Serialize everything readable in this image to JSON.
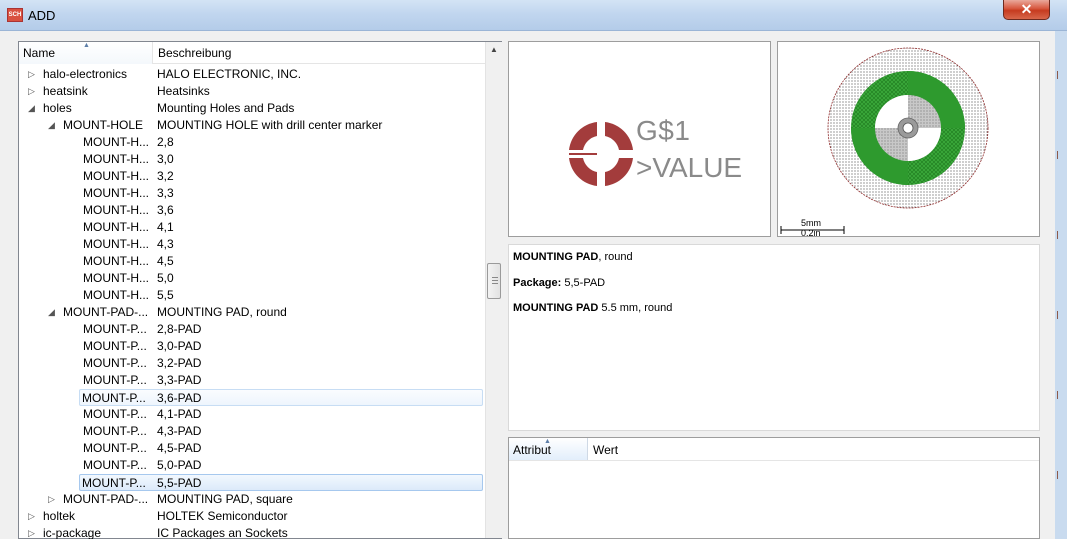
{
  "window": {
    "title": "ADD",
    "app_icon": "SCH",
    "close_label": "✕"
  },
  "tree": {
    "columns": {
      "name": "Name",
      "description": "Beschreibung"
    },
    "rows": [
      {
        "level": 0,
        "expander": "collapsed",
        "name": "halo-electronics",
        "desc": "HALO ELECTRONIC, INC."
      },
      {
        "level": 0,
        "expander": "collapsed",
        "name": "heatsink",
        "desc": "Heatsinks"
      },
      {
        "level": 0,
        "expander": "expanded",
        "name": "holes",
        "desc": "Mounting Holes and Pads"
      },
      {
        "level": 1,
        "expander": "expanded",
        "name": "MOUNT-HOLE",
        "desc": "MOUNTING HOLE with drill center marker"
      },
      {
        "level": 2,
        "expander": "none",
        "name": "MOUNT-H...",
        "desc": "2,8"
      },
      {
        "level": 2,
        "expander": "none",
        "name": "MOUNT-H...",
        "desc": "3,0"
      },
      {
        "level": 2,
        "expander": "none",
        "name": "MOUNT-H...",
        "desc": "3,2"
      },
      {
        "level": 2,
        "expander": "none",
        "name": "MOUNT-H...",
        "desc": "3,3"
      },
      {
        "level": 2,
        "expander": "none",
        "name": "MOUNT-H...",
        "desc": "3,6"
      },
      {
        "level": 2,
        "expander": "none",
        "name": "MOUNT-H...",
        "desc": "4,1"
      },
      {
        "level": 2,
        "expander": "none",
        "name": "MOUNT-H...",
        "desc": "4,3"
      },
      {
        "level": 2,
        "expander": "none",
        "name": "MOUNT-H...",
        "desc": "4,5"
      },
      {
        "level": 2,
        "expander": "none",
        "name": "MOUNT-H...",
        "desc": "5,0"
      },
      {
        "level": 2,
        "expander": "none",
        "name": "MOUNT-H...",
        "desc": "5,5"
      },
      {
        "level": 1,
        "expander": "expanded",
        "name": "MOUNT-PAD-...",
        "desc": "MOUNTING PAD, round"
      },
      {
        "level": 2,
        "expander": "none",
        "name": "MOUNT-P...",
        "desc": "2,8-PAD"
      },
      {
        "level": 2,
        "expander": "none",
        "name": "MOUNT-P...",
        "desc": "3,0-PAD"
      },
      {
        "level": 2,
        "expander": "none",
        "name": "MOUNT-P...",
        "desc": "3,2-PAD"
      },
      {
        "level": 2,
        "expander": "none",
        "name": "MOUNT-P...",
        "desc": "3,3-PAD"
      },
      {
        "level": 2,
        "expander": "none",
        "name": "MOUNT-P...",
        "desc": "3,6-PAD",
        "state": "hover"
      },
      {
        "level": 2,
        "expander": "none",
        "name": "MOUNT-P...",
        "desc": "4,1-PAD"
      },
      {
        "level": 2,
        "expander": "none",
        "name": "MOUNT-P...",
        "desc": "4,3-PAD"
      },
      {
        "level": 2,
        "expander": "none",
        "name": "MOUNT-P...",
        "desc": "4,5-PAD"
      },
      {
        "level": 2,
        "expander": "none",
        "name": "MOUNT-P...",
        "desc": "5,0-PAD"
      },
      {
        "level": 2,
        "expander": "none",
        "name": "MOUNT-P...",
        "desc": "5,5-PAD",
        "state": "selected"
      },
      {
        "level": 1,
        "expander": "collapsed",
        "name": "MOUNT-PAD-...",
        "desc": "MOUNTING PAD, square"
      },
      {
        "level": 0,
        "expander": "collapsed",
        "name": "holtek",
        "desc": "HOLTEK Semiconductor"
      },
      {
        "level": 0,
        "expander": "collapsed",
        "name": "ic-package",
        "desc": "IC Packages an Sockets"
      }
    ]
  },
  "symbol_preview": {
    "name": "G$1",
    "value": ">VALUE"
  },
  "package_preview": {
    "scale_metric": "5mm",
    "scale_imperial": "0.2in"
  },
  "description": {
    "line1_bold": "MOUNTING PAD",
    "line1_rest": ", round",
    "line2_bold": "Package:",
    "line2_rest": " 5,5-PAD",
    "line3_bold": "MOUNTING PAD",
    "line3_rest": " 5.5 mm, round"
  },
  "attributes": {
    "columns": {
      "attribute": "Attribut",
      "value": "Wert"
    }
  },
  "colors": {
    "symbol_red": "#a33c3c",
    "pad_green": "#2e8b2e",
    "selection": "#dceafa"
  }
}
